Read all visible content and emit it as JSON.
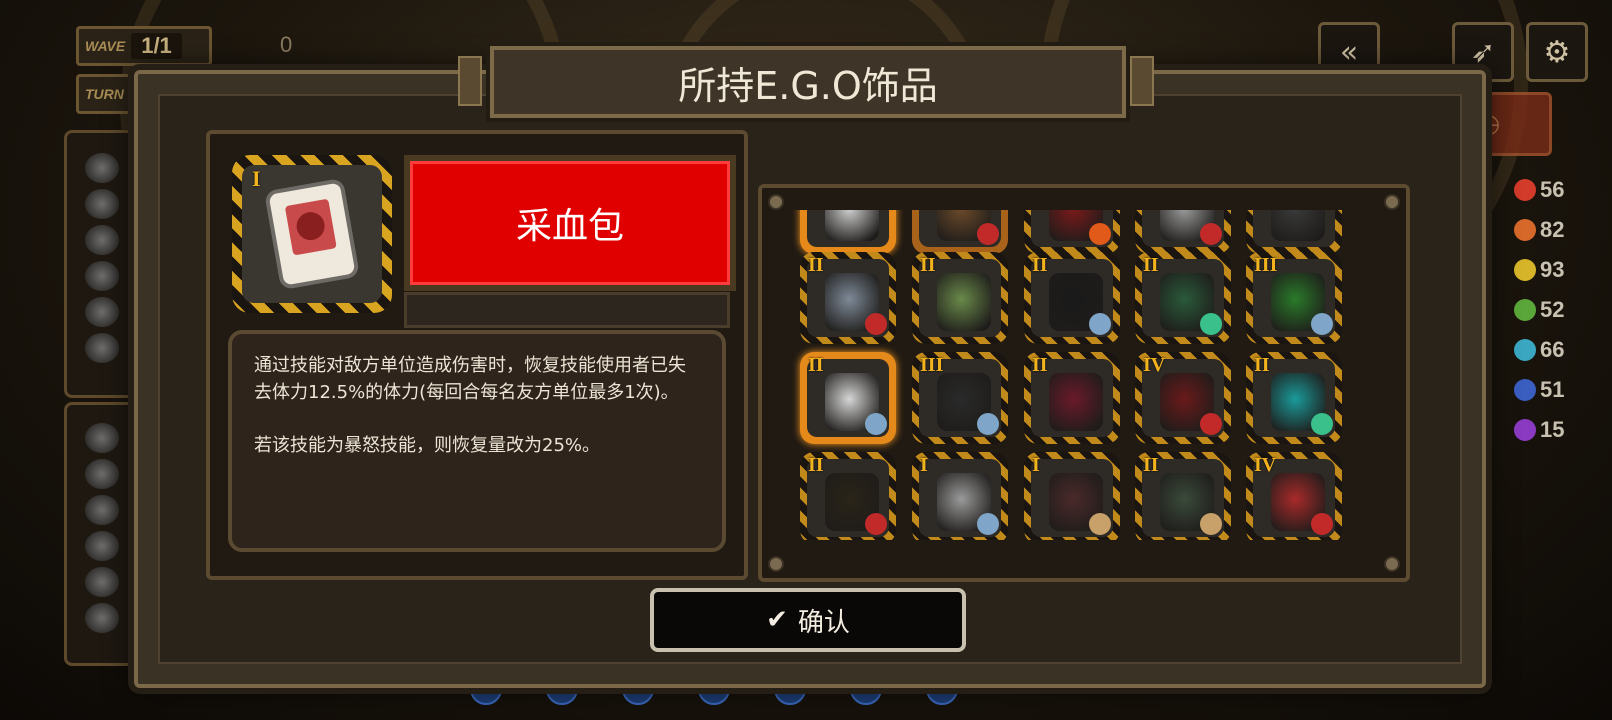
{
  "hud": {
    "wave_label": "WAVE",
    "wave_value": "1/1",
    "turn_label": "TURN",
    "score": "0"
  },
  "top_right": {
    "rewind_icon": "double-chevron-left",
    "feather_icon": "feather-icon",
    "settings_icon": "gear-icon"
  },
  "resources": [
    {
      "value": "56",
      "color": "#d23a2a"
    },
    {
      "value": "82",
      "color": "#d6682a"
    },
    {
      "value": "93",
      "color": "#d6b42a"
    },
    {
      "value": "52",
      "color": "#5aa63a"
    },
    {
      "value": "66",
      "color": "#3aa6c0"
    },
    {
      "value": "51",
      "color": "#3a5ec0"
    },
    {
      "value": "15",
      "color": "#8a3ac0"
    }
  ],
  "modal": {
    "title": "所持E.G.O饰品",
    "selected": {
      "rank": "I",
      "name": "采血包",
      "name_color": "#e10000",
      "description_1": "通过技能对敌方单位造成伤害时，恢复技能使用者已失去体力12.5%的体力(每回合每名友方单位最多1次)。",
      "description_2": "若该技能为暴怒技能，则恢复量改为25%。"
    },
    "grid_rows": [
      [
        {
          "rank": "",
          "color": "#cfcfcf",
          "badge": "",
          "frame": "orange"
        },
        {
          "rank": "",
          "color": "#6b4a2a",
          "badge": "#c22a2a",
          "frame": "orange-dim"
        },
        {
          "rank": "",
          "color": "#7a1a1a",
          "badge": "#e25a1a",
          "frame": "stripe"
        },
        {
          "rank": "",
          "color": "#9a9a9a",
          "badge": "#c22a2a",
          "frame": "stripe"
        },
        {
          "rank": "",
          "color": "#3a3a3a",
          "badge": "",
          "frame": "stripe"
        }
      ],
      [
        {
          "rank": "II",
          "color": "#7e8a98",
          "badge": "#c22a2a",
          "frame": "stripe"
        },
        {
          "rank": "II",
          "color": "#6a8a4a",
          "badge": "",
          "frame": "stripe"
        },
        {
          "rank": "II",
          "color": "#1a1a1a",
          "badge": "#7fa6c8",
          "frame": "stripe"
        },
        {
          "rank": "II",
          "color": "#2a5a3a",
          "badge": "#3ac08a",
          "frame": "stripe"
        },
        {
          "rank": "III",
          "color": "#2a7a2a",
          "badge": "#7fa6c8",
          "frame": "stripe"
        }
      ],
      [
        {
          "rank": "II",
          "color": "#d6d6d6",
          "badge": "#7fa6c8",
          "frame": "orange"
        },
        {
          "rank": "III",
          "color": "#2a2a2a",
          "badge": "#7fa6c8",
          "frame": "stripe"
        },
        {
          "rank": "II",
          "color": "#6a1a2a",
          "badge": "",
          "frame": "stripe"
        },
        {
          "rank": "IV",
          "color": "#6a1a1a",
          "badge": "#c22a2a",
          "frame": "stripe"
        },
        {
          "rank": "II",
          "color": "#1a9a9a",
          "badge": "#3ac08a",
          "frame": "stripe"
        }
      ],
      [
        {
          "rank": "II",
          "color": "#2a2418",
          "badge": "#c22a2a",
          "frame": "stripe"
        },
        {
          "rank": "I",
          "color": "#9a9a9a",
          "badge": "#7fa6c8",
          "frame": "stripe"
        },
        {
          "rank": "I",
          "color": "#4a2a2a",
          "badge": "#c8a06a",
          "frame": "stripe"
        },
        {
          "rank": "II",
          "color": "#3a4a3a",
          "badge": "#c8a06a",
          "frame": "stripe"
        },
        {
          "rank": "IV",
          "color": "#a82a2a",
          "badge": "#c22a2a",
          "frame": "stripe"
        }
      ]
    ],
    "confirm_label": "确认"
  }
}
